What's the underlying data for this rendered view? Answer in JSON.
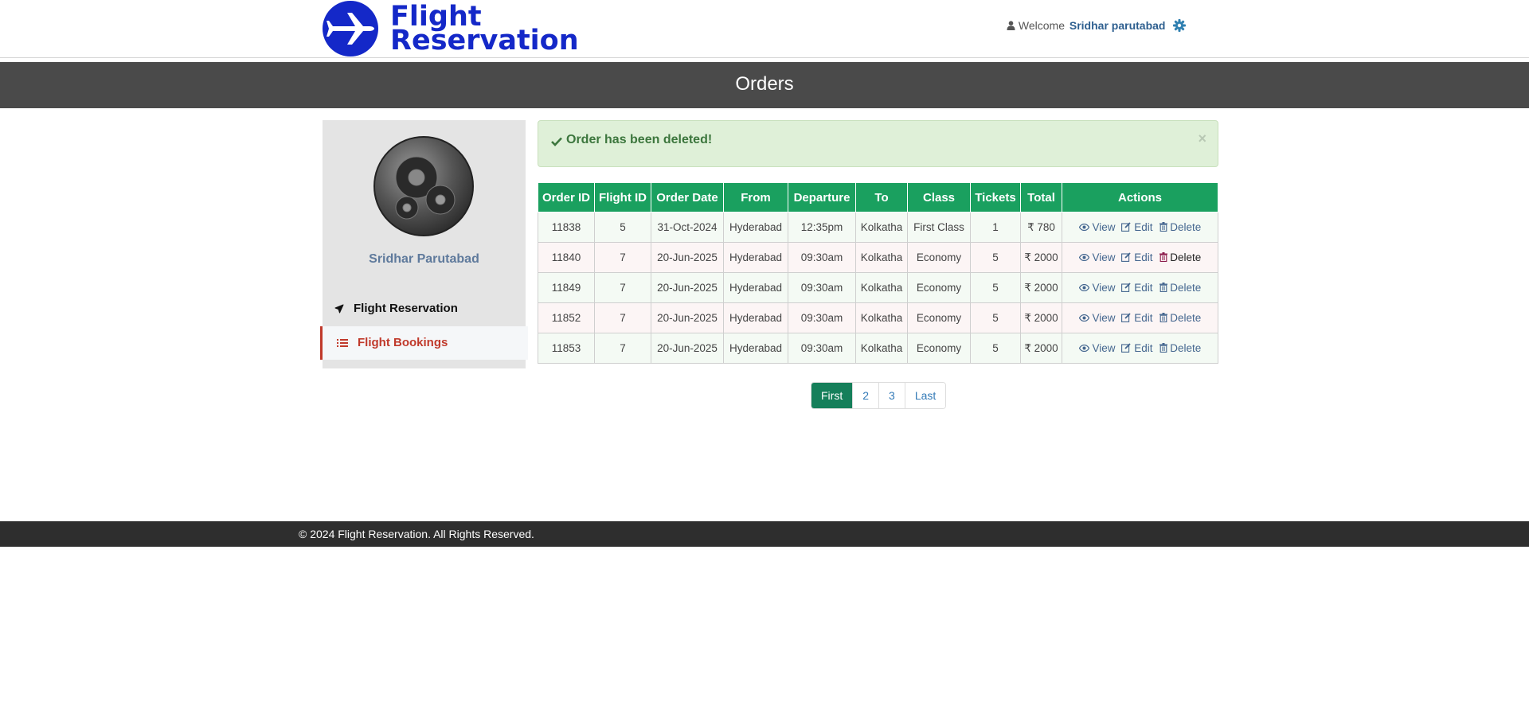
{
  "header": {
    "logo_line1": "Flight",
    "logo_line2": "Reservation",
    "welcome_label": "Welcome",
    "user_name": "Sridhar parutabad"
  },
  "page_title": "Orders",
  "sidebar": {
    "profile_name": "Sridhar Parutabad",
    "items": [
      {
        "label": "Flight Reservation",
        "active": false
      },
      {
        "label": "Flight Bookings",
        "active": true
      }
    ]
  },
  "alert": {
    "message": "Order has been deleted!",
    "close": "×"
  },
  "table": {
    "headers": [
      "Order ID",
      "Flight ID",
      "Order Date",
      "From",
      "Departure",
      "To",
      "Class",
      "Tickets",
      "Total",
      "Actions"
    ],
    "currency_symbol": "₹",
    "rows": [
      {
        "order_id": "11838",
        "flight_id": "5",
        "order_date": "31-Oct-2024",
        "from": "Hyderabad",
        "departure": "12:35pm",
        "to": "Kolkatha",
        "class": "First Class",
        "tickets": "1",
        "total": "₹ 780"
      },
      {
        "order_id": "11840",
        "flight_id": "7",
        "order_date": "20-Jun-2025",
        "from": "Hyderabad",
        "departure": "09:30am",
        "to": "Kolkatha",
        "class": "Economy",
        "tickets": "5",
        "total": "₹ 2000"
      },
      {
        "order_id": "11849",
        "flight_id": "7",
        "order_date": "20-Jun-2025",
        "from": "Hyderabad",
        "departure": "09:30am",
        "to": "Kolkatha",
        "class": "Economy",
        "tickets": "5",
        "total": "₹ 2000"
      },
      {
        "order_id": "11852",
        "flight_id": "7",
        "order_date": "20-Jun-2025",
        "from": "Hyderabad",
        "departure": "09:30am",
        "to": "Kolkatha",
        "class": "Economy",
        "tickets": "5",
        "total": "₹ 2000"
      },
      {
        "order_id": "11853",
        "flight_id": "7",
        "order_date": "20-Jun-2025",
        "from": "Hyderabad",
        "departure": "09:30am",
        "to": "Kolkatha",
        "class": "Economy",
        "tickets": "5",
        "total": "₹ 2000"
      }
    ],
    "actions": {
      "view": "View",
      "edit": "Edit",
      "delete": "Delete"
    }
  },
  "pagination": {
    "items": [
      "First",
      "2",
      "3",
      "Last"
    ],
    "active": "First"
  },
  "footer": {
    "text": "© 2024 Flight Reservation. All Rights Reserved."
  },
  "colors": {
    "brand_blue": "#1428c8",
    "table_header": "#1aa05f",
    "active_nav": "#c0392b",
    "pager_active": "#157f5a",
    "title_bar": "#4a4a4a",
    "footer": "#2e2e2e"
  },
  "icons": {
    "logo": "airplane-icon",
    "user": "user-icon",
    "settings": "gear-icon",
    "nav_reservation": "plane-icon",
    "nav_bookings": "list-icon",
    "alert": "check-icon",
    "view": "eye-icon",
    "edit": "edit-icon",
    "delete": "trash-icon"
  }
}
